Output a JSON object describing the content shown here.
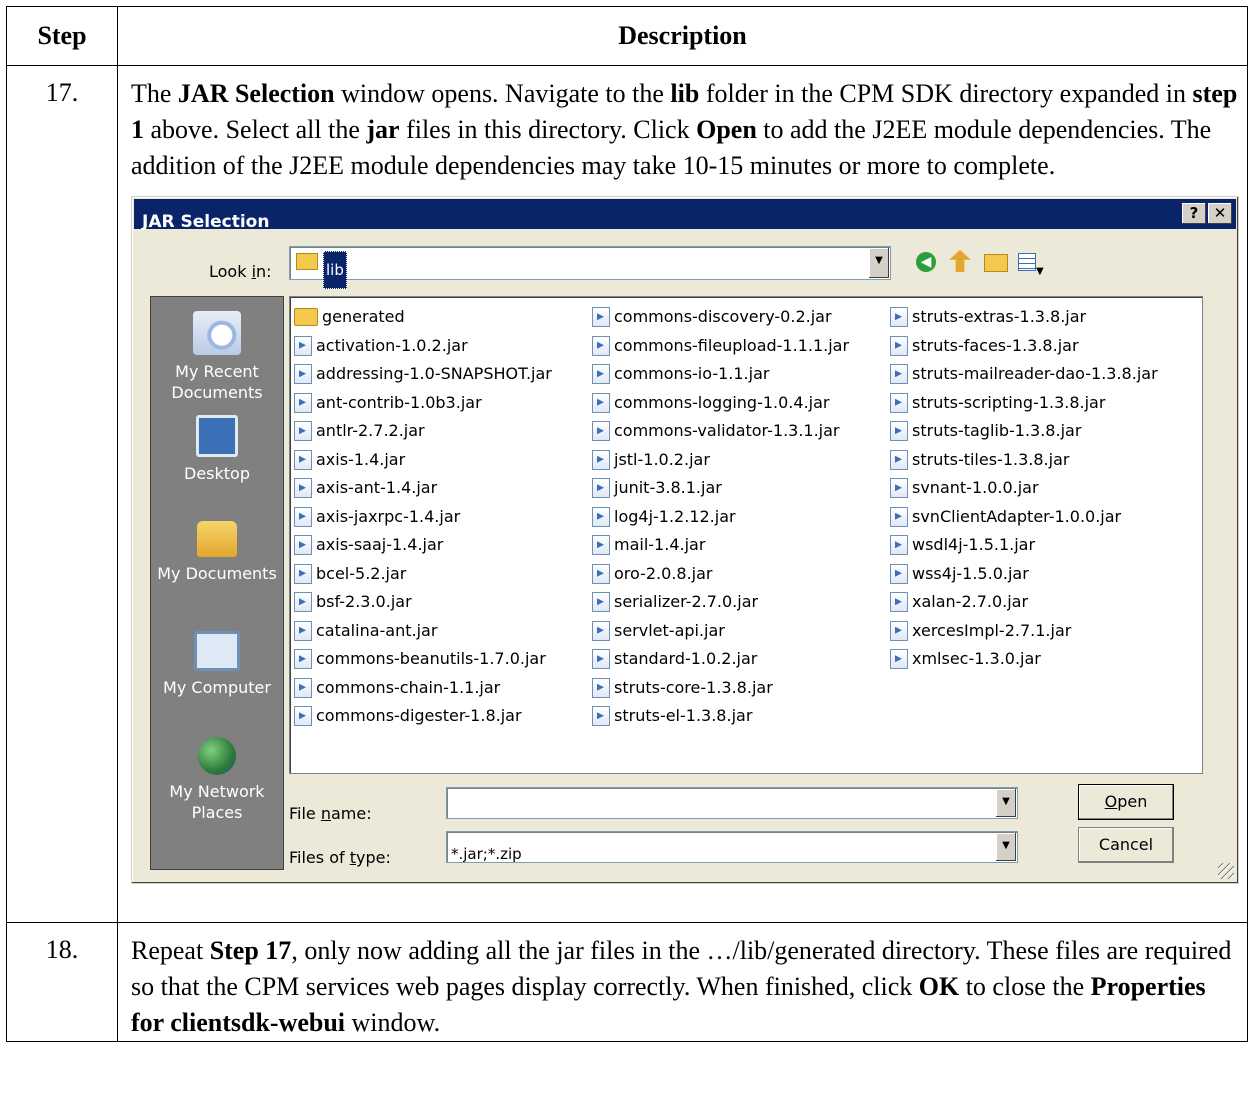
{
  "table": {
    "header_step": "Step",
    "header_description": "Description"
  },
  "rows": [
    {
      "step": "17.",
      "text_parts": [
        {
          "t": "The ",
          "b": false
        },
        {
          "t": "JAR Selection",
          "b": true
        },
        {
          "t": " window opens. Navigate to the ",
          "b": false
        },
        {
          "t": "lib",
          "b": true
        },
        {
          "t": " folder in the CPM SDK directory expanded in ",
          "b": false
        },
        {
          "t": "step 1",
          "b": true
        },
        {
          "t": " above. Select all the ",
          "b": false
        },
        {
          "t": "jar",
          "b": true
        },
        {
          "t": " files in this directory. Click ",
          "b": false
        },
        {
          "t": "Open",
          "b": true
        },
        {
          "t": " to add the J2EE module dependencies. The addition of the J2EE module dependencies may take 10-15 minutes or more to complete.",
          "b": false
        }
      ]
    },
    {
      "step": "18.",
      "text_parts": [
        {
          "t": "Repeat ",
          "b": false
        },
        {
          "t": "Step 17",
          "b": true
        },
        {
          "t": ", only now adding all the jar files in the …/lib/generated directory. These files are required so that the CPM services web pages display correctly. When finished, click ",
          "b": false
        },
        {
          "t": "OK",
          "b": true
        },
        {
          "t": " to close the ",
          "b": false
        },
        {
          "t": "Properties for clientsdk-webui",
          "b": true
        },
        {
          "t": " window.",
          "b": false
        }
      ]
    }
  ],
  "dialog": {
    "title": "JAR Selection",
    "help_button": "?",
    "close_button": "✕",
    "look_in_label_pre": "Look ",
    "look_in_label_u": "i",
    "look_in_label_post": "n:",
    "look_in_value": "lib",
    "places": [
      "My Recent\nDocuments",
      "Desktop",
      "My Documents",
      "My Computer",
      "My Network\nPlaces"
    ],
    "files": {
      "col1": [
        "generated",
        "activation-1.0.2.jar",
        "addressing-1.0-SNAPSHOT.jar",
        "ant-contrib-1.0b3.jar",
        "antlr-2.7.2.jar",
        "axis-1.4.jar",
        "axis-ant-1.4.jar",
        "axis-jaxrpc-1.4.jar",
        "axis-saaj-1.4.jar",
        "bcel-5.2.jar",
        "bsf-2.3.0.jar",
        "catalina-ant.jar",
        "commons-beanutils-1.7.0.jar",
        "commons-chain-1.1.jar",
        "commons-digester-1.8.jar"
      ],
      "col2": [
        "commons-discovery-0.2.jar",
        "commons-fileupload-1.1.1.jar",
        "commons-io-1.1.jar",
        "commons-logging-1.0.4.jar",
        "commons-validator-1.3.1.jar",
        "jstl-1.0.2.jar",
        "junit-3.8.1.jar",
        "log4j-1.2.12.jar",
        "mail-1.4.jar",
        "oro-2.0.8.jar",
        "serializer-2.7.0.jar",
        "servlet-api.jar",
        "standard-1.0.2.jar",
        "struts-core-1.3.8.jar",
        "struts-el-1.3.8.jar"
      ],
      "col3": [
        "struts-extras-1.3.8.jar",
        "struts-faces-1.3.8.jar",
        "struts-mailreader-dao-1.3.8.jar",
        "struts-scripting-1.3.8.jar",
        "struts-taglib-1.3.8.jar",
        "struts-tiles-1.3.8.jar",
        "svnant-1.0.0.jar",
        "svnClientAdapter-1.0.0.jar",
        "wsdl4j-1.5.1.jar",
        "wss4j-1.5.0.jar",
        "xalan-2.7.0.jar",
        "xercesImpl-2.7.1.jar",
        "xmlsec-1.3.0.jar"
      ]
    },
    "file_name_label_pre": "File ",
    "file_name_label_u": "n",
    "file_name_label_post": "ame:",
    "file_name_value": "",
    "files_of_type_label_pre": "Files of ",
    "files_of_type_label_u": "t",
    "files_of_type_label_post": "ype:",
    "files_of_type_value": "*.jar;*.zip",
    "open_u": "O",
    "open_rest": "pen",
    "cancel_label": "Cancel"
  }
}
